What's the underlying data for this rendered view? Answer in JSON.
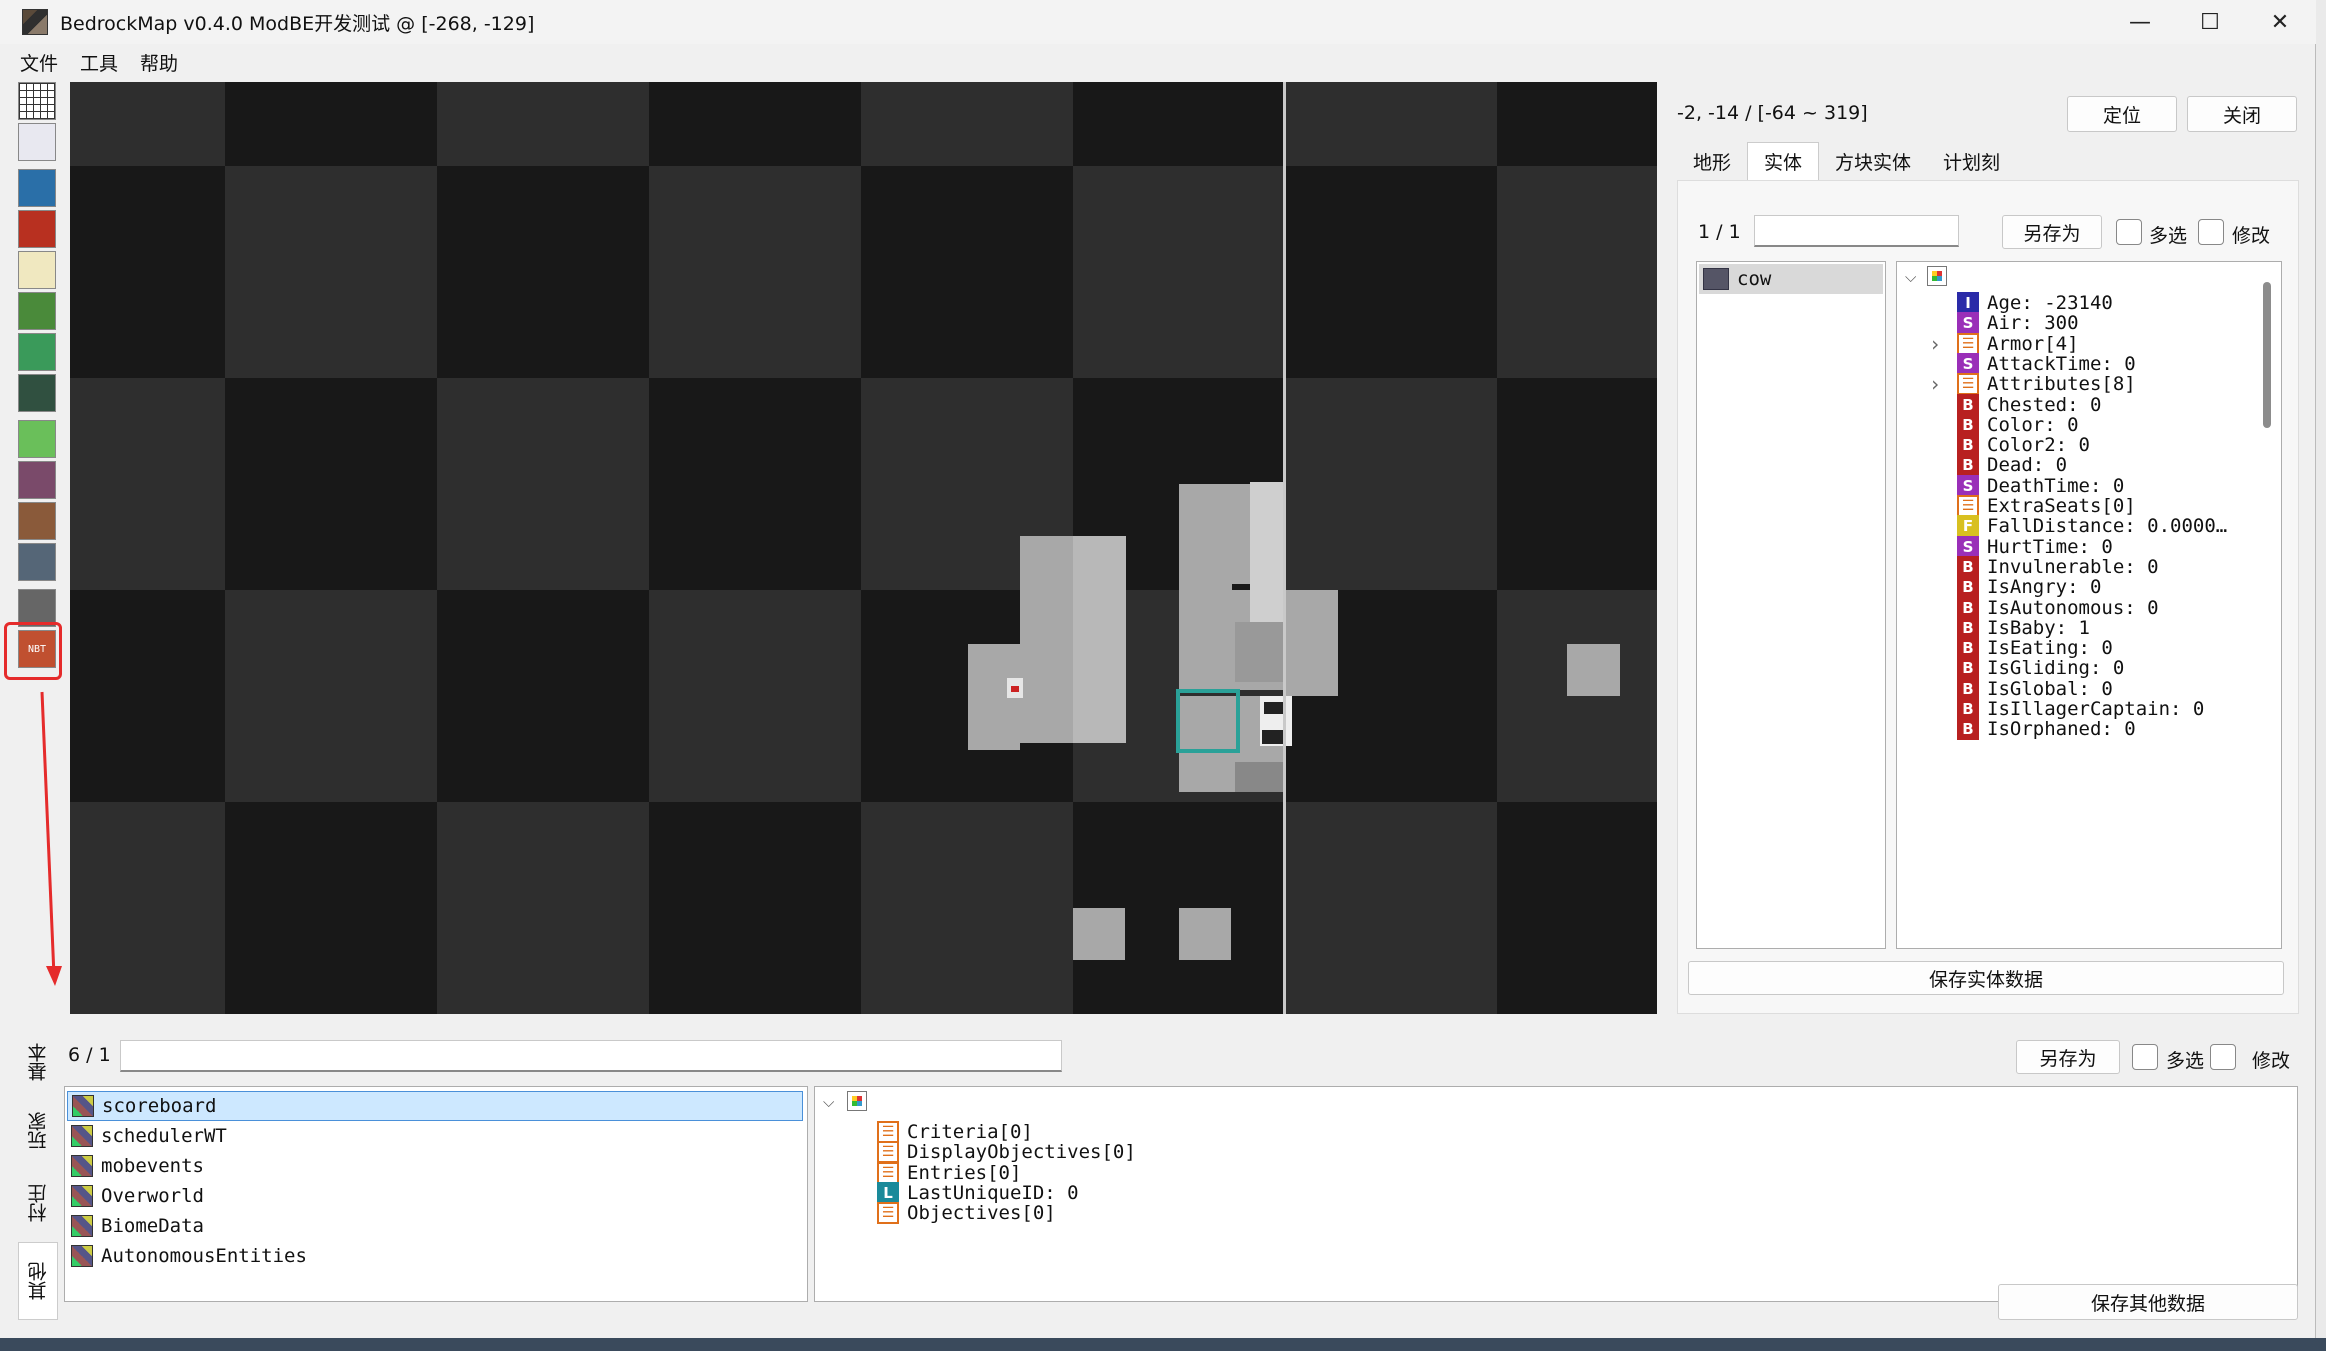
{
  "window": {
    "title": "BedrockMap v0.4.0 ModBE开发测试 @  [-268, -129]",
    "minimize": "—",
    "maximize": "☐",
    "close": "✕"
  },
  "menu": [
    "文件",
    "工具",
    "帮助"
  ],
  "tools": [
    {
      "name": "grid-icon",
      "color": "#ffffff"
    },
    {
      "name": "selection-icon",
      "color": "#e8e8f0"
    },
    {
      "name": "globe-icon",
      "color": "#2a6fa8"
    },
    {
      "name": "red-cube-icon",
      "color": "#b83020"
    },
    {
      "name": "dice-icon",
      "color": "#f0e8c0"
    },
    {
      "name": "terrain-icon",
      "color": "#4a8a3a"
    },
    {
      "name": "biome-map-icon",
      "color": "#3a9a5a"
    },
    {
      "name": "height-map-icon",
      "color": "#305040"
    },
    {
      "name": "slime-icon",
      "color": "#6abf5a"
    },
    {
      "name": "pixel-art-icon",
      "color": "#7a4a6a"
    },
    {
      "name": "villager-icon",
      "color": "#8a5a3a"
    },
    {
      "name": "entity-icon",
      "color": "#556677"
    },
    {
      "name": "structure-icon",
      "color": "#666666"
    },
    {
      "name": "nbt-icon",
      "color": "#c05030",
      "text": "NBT"
    }
  ],
  "right": {
    "coord": "-2, -14 / [-64 ~ 319]",
    "locate_btn": "定位",
    "close_btn": "关闭",
    "tabs": [
      "地形",
      "实体",
      "方块实体",
      "计划刻"
    ],
    "active_tab": 1,
    "page": "1 / 1",
    "save_as": "另存为",
    "multi": "多选",
    "modify": "修改",
    "entity_list": [
      "cow"
    ],
    "nbt": [
      {
        "t": "I",
        "c": "#2a2aa8",
        "text": "Age: -23140"
      },
      {
        "t": "S",
        "c": "#9a2fb8",
        "text": "Air: 300"
      },
      {
        "t": "list",
        "text": "Armor[4]",
        "exp": true
      },
      {
        "t": "S",
        "c": "#9a2fb8",
        "text": "AttackTime: 0"
      },
      {
        "t": "list",
        "text": "Attributes[8]",
        "exp": true
      },
      {
        "t": "B",
        "c": "#b82020",
        "text": "Chested: 0"
      },
      {
        "t": "B",
        "c": "#b82020",
        "text": "Color: 0"
      },
      {
        "t": "B",
        "c": "#b82020",
        "text": "Color2: 0"
      },
      {
        "t": "B",
        "c": "#b82020",
        "text": "Dead: 0"
      },
      {
        "t": "S",
        "c": "#9a2fb8",
        "text": "DeathTime: 0"
      },
      {
        "t": "list",
        "text": "ExtraSeats[0]"
      },
      {
        "t": "F",
        "c": "#d8c020",
        "text": "FallDistance: 0.0000…"
      },
      {
        "t": "S",
        "c": "#9a2fb8",
        "text": "HurtTime: 0"
      },
      {
        "t": "B",
        "c": "#b82020",
        "text": "Invulnerable: 0"
      },
      {
        "t": "B",
        "c": "#b82020",
        "text": "IsAngry: 0"
      },
      {
        "t": "B",
        "c": "#b82020",
        "text": "IsAutonomous: 0"
      },
      {
        "t": "B",
        "c": "#b82020",
        "text": "IsBaby: 1"
      },
      {
        "t": "B",
        "c": "#b82020",
        "text": "IsEating: 0"
      },
      {
        "t": "B",
        "c": "#b82020",
        "text": "IsGliding: 0"
      },
      {
        "t": "B",
        "c": "#b82020",
        "text": "IsGlobal: 0"
      },
      {
        "t": "B",
        "c": "#b82020",
        "text": "IsIllagerCaptain: 0"
      },
      {
        "t": "B",
        "c": "#b82020",
        "text": "IsOrphaned: 0"
      }
    ],
    "save_entity": "保存实体数据"
  },
  "bottom": {
    "vtabs": [
      "基本",
      "玩家",
      "村庄",
      "其他"
    ],
    "active_vtab": 3,
    "page": "6 / 1",
    "save_as": "另存为",
    "multi": "多选",
    "modify": "修改",
    "list": [
      "scoreboard",
      "schedulerWT",
      "mobevents",
      "Overworld",
      "BiomeData",
      "AutonomousEntities"
    ],
    "selected": 0,
    "nbt": [
      {
        "t": "list",
        "text": "Criteria[0]"
      },
      {
        "t": "list",
        "text": "DisplayObjectives[0]"
      },
      {
        "t": "list",
        "text": "Entries[0]"
      },
      {
        "t": "L",
        "c": "#1a8a9a",
        "text": "LastUniqueID: 0"
      },
      {
        "t": "list",
        "text": "Objectives[0]"
      }
    ],
    "save_other": "保存其他数据"
  }
}
